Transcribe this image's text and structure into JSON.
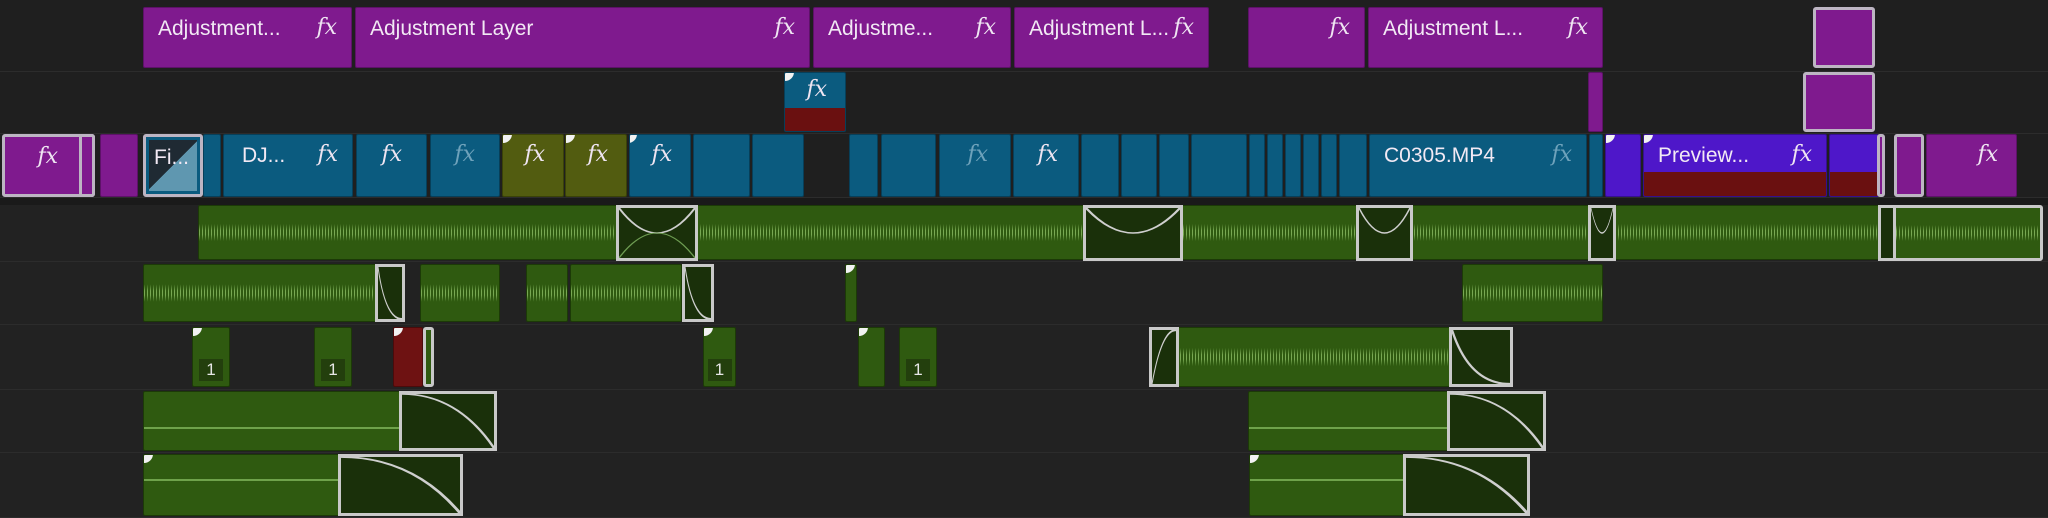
{
  "timeline": {
    "adjustment_track": {
      "clips": [
        {
          "label": "Adjustment...",
          "fx": "fx"
        },
        {
          "label": "Adjustment Layer",
          "fx": "fx"
        },
        {
          "label": "Adjustme...",
          "fx": "fx"
        },
        {
          "label": "Adjustment L...",
          "fx": "fx"
        },
        {
          "label": "",
          "fx": "fx"
        },
        {
          "label": "Adjustment L...",
          "fx": "fx"
        }
      ]
    },
    "overlay_track": {
      "clips": [
        {
          "label": "",
          "fx": "fx"
        }
      ]
    },
    "main_video_track": {
      "clips": [
        {
          "label": "",
          "fx": "fx"
        },
        {
          "label": "Fi...",
          "fx": ""
        },
        {
          "label": "DJ...",
          "fx": "fx"
        },
        {
          "label": "",
          "fx": "fx"
        },
        {
          "label": "",
          "fx": "fx"
        },
        {
          "label": "",
          "fx": "fx"
        },
        {
          "label": "",
          "fx": "fx"
        },
        {
          "label": "",
          "fx": "fx"
        },
        {
          "label": "",
          "fx": "fx"
        },
        {
          "label": "",
          "fx": "fx"
        },
        {
          "label": "C0305.MP4",
          "fx": "fx"
        },
        {
          "label": "Preview...",
          "fx": "fx"
        },
        {
          "label": "",
          "fx": "fx"
        }
      ]
    },
    "audio_badges": [
      "1",
      "1",
      "1",
      "1"
    ],
    "colors": {
      "background": "#232323",
      "adjustment_clip": "#7f1a8e",
      "video_clip": "#0b5b7f",
      "olive_clip": "#525c10",
      "preview_clip": "#4e17c9",
      "audio_clip": "#2f5a10",
      "selection_border": "#c9c9c9"
    }
  }
}
